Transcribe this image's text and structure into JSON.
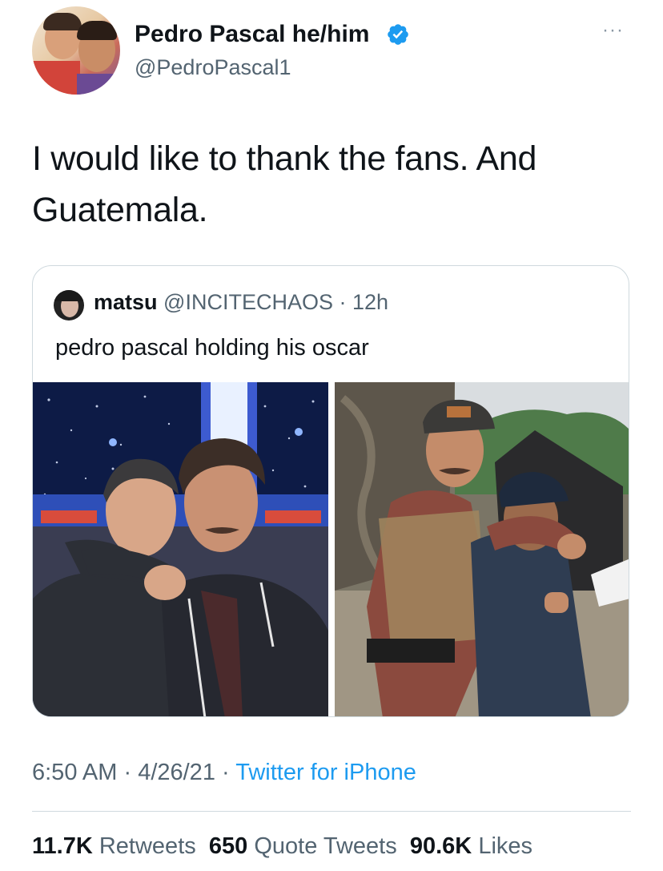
{
  "author": {
    "name": "Pedro Pascal he/him",
    "handle": "@PedroPascal1",
    "verified_icon": "verified-badge-icon",
    "more_label": "···"
  },
  "tweet": {
    "text_line1": "I would like to thank the fans. And",
    "text_line2": "Guatemala."
  },
  "quoted_tweet": {
    "name": "matsu",
    "handle": "@INCITECHAOS",
    "separator": " · ",
    "time": "12h",
    "text": "pedro pascal holding his oscar"
  },
  "meta": {
    "time": "6:50 AM",
    "sep1": " · ",
    "date": "4/26/21",
    "sep2": " · ",
    "source": "Twitter for iPhone"
  },
  "stats": {
    "retweets_count": "11.7K",
    "retweets_label": "Retweets",
    "quotes_count": "650",
    "quotes_label": "Quote Tweets",
    "likes_count": "90.6K",
    "likes_label": "Likes"
  },
  "colors": {
    "link": "#1d9bf0",
    "secondary_text": "#536471",
    "border": "#cfd9de"
  }
}
